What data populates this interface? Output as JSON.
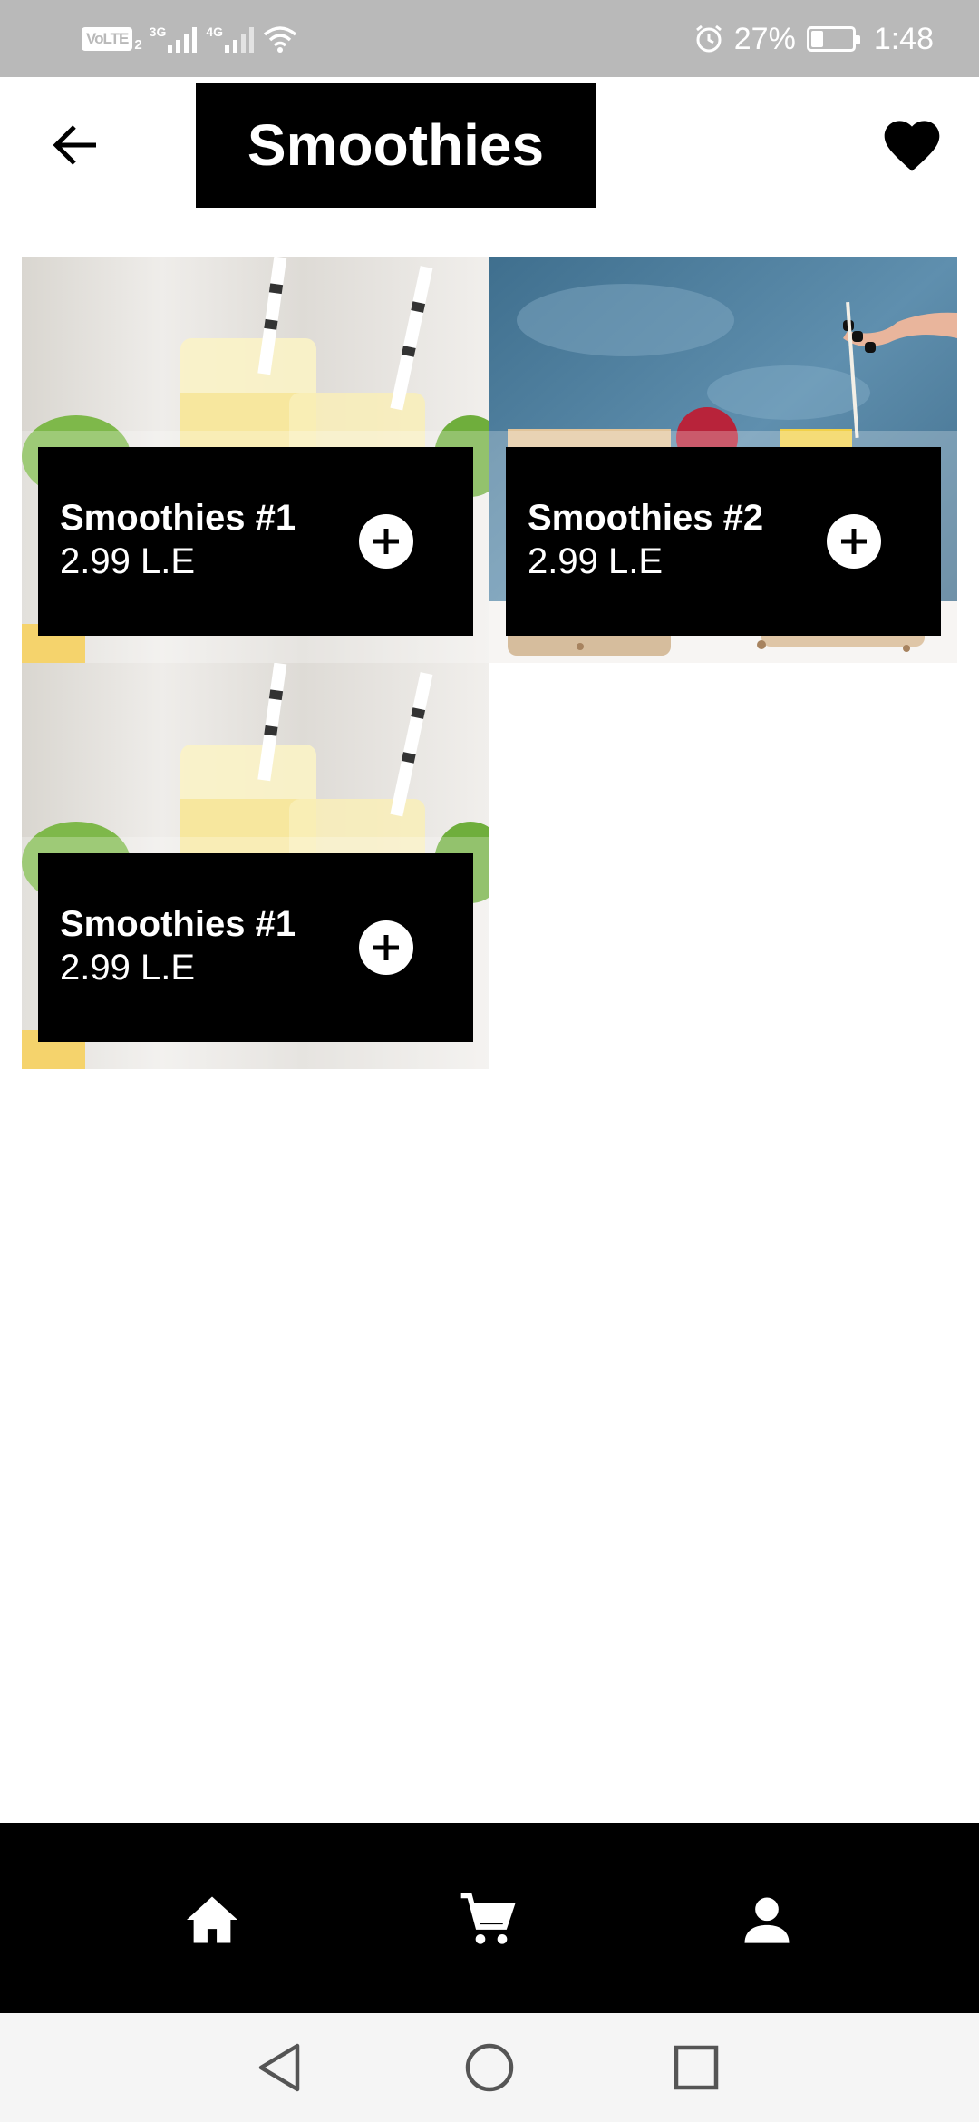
{
  "status_bar": {
    "volte": "VoLTE",
    "sim": "2",
    "network_1": "3G",
    "network_2": "4G",
    "battery": "27%",
    "time": "1:48",
    "battery_level": 0.27
  },
  "header": {
    "title": "Smoothies",
    "back_icon": "arrow-left-icon",
    "favorite_icon": "heart-icon"
  },
  "products": [
    {
      "name": "Smoothies #1",
      "price": "2.99 L.E",
      "image": "glass-smoothie-photo"
    },
    {
      "name": "Smoothies #2",
      "price": "2.99 L.E",
      "image": "granola-bowl-photo"
    },
    {
      "name": "Smoothies #1",
      "price": "2.99 L.E",
      "image": "glass-smoothie-photo"
    }
  ],
  "bottom_nav": {
    "items": [
      {
        "icon": "home-icon"
      },
      {
        "icon": "cart-icon"
      },
      {
        "icon": "person-icon"
      }
    ]
  },
  "system_nav": {
    "items": [
      {
        "icon": "back-triangle-icon"
      },
      {
        "icon": "home-circle-icon"
      },
      {
        "icon": "recents-square-icon"
      }
    ]
  },
  "colors": {
    "primary": "#000000",
    "on_primary": "#ffffff",
    "status_bar": "#b9b9b9"
  }
}
